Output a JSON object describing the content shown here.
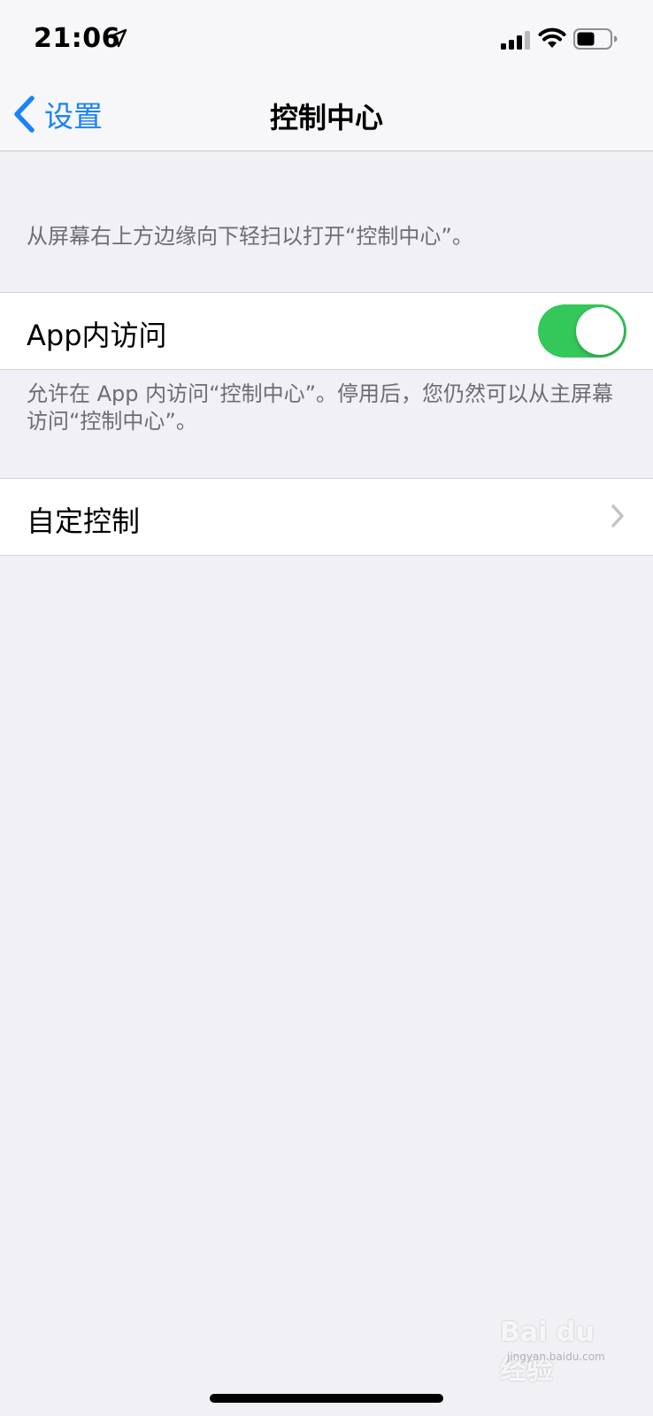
{
  "status_bar": {
    "time": "21:06",
    "icons": [
      "location-arrow-icon",
      "signal-icon",
      "wifi-icon",
      "battery-icon"
    ]
  },
  "nav": {
    "back_label": "设置",
    "title": "控制中心"
  },
  "content": {
    "top_note": "从屏幕右上方边缘向下轻扫以打开“控制中心”。",
    "app_access": {
      "label": "App内访问",
      "toggle_on": true
    },
    "app_access_note": "允许在 App 内访问“控制中心”。停用后，您仍然可以从主屏幕访问“控制中心”。",
    "customize": {
      "label": "自定控制"
    }
  },
  "watermark": {
    "main": "Bai du 经验",
    "sub": "jingyan.baidu.com"
  },
  "colors": {
    "accent": "#1a82fb",
    "toggle_on": "#34c759",
    "background": "#f0f0f5",
    "secondary_text": "#6d6d72"
  }
}
